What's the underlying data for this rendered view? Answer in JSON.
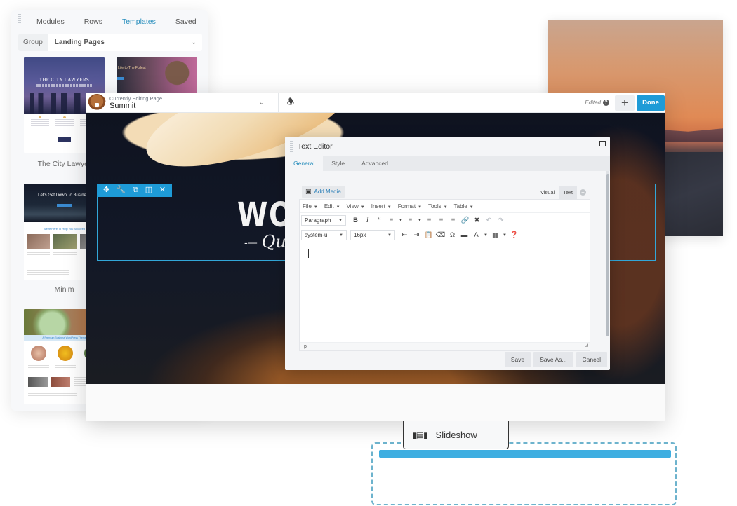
{
  "library": {
    "tabs": [
      {
        "label": "Modules",
        "active": false
      },
      {
        "label": "Rows",
        "active": false
      },
      {
        "label": "Templates",
        "active": true
      },
      {
        "label": "Saved",
        "active": false
      }
    ],
    "group_label": "Group",
    "group_value": "Landing Pages",
    "templates": [
      {
        "name": "The City Lawyers",
        "thumb_title": "THE CITY LAWYERS"
      },
      {
        "name": "",
        "thumb_title": "Life to The Fullest"
      },
      {
        "name": "Minim",
        "thumb_title": "Let's Get Down To Business",
        "section": "We're Here To Help You Succeed"
      },
      {
        "name": "",
        "thumb_title": "",
        "section": "A Premium Business WordPress Theme"
      }
    ],
    "visible_label_city": "The City Lawyer"
  },
  "builder": {
    "page_caption": "Currently Editing Page",
    "page_name": "Summit",
    "status": "Edited",
    "add_label": "+",
    "done_label": "Done",
    "hero_title": "WOO",
    "hero_sub": "Qu",
    "accent": "#1e9bd7"
  },
  "row_toolbar": {
    "icons": [
      "move-icon",
      "wrench-icon",
      "duplicate-icon",
      "columns-icon",
      "close-icon"
    ]
  },
  "dialog": {
    "title": "Text Editor",
    "tabs": [
      {
        "label": "General",
        "active": true
      },
      {
        "label": "Style",
        "active": false
      },
      {
        "label": "Advanced",
        "active": false
      }
    ],
    "add_media": "Add Media",
    "modes": {
      "visual": "Visual",
      "text": "Text"
    },
    "menu": [
      "File",
      "Edit",
      "View",
      "Insert",
      "Format",
      "Tools",
      "Table"
    ],
    "block_format": "Paragraph",
    "font_family": "system-ui",
    "font_size": "16px",
    "status_path": "p",
    "buttons": {
      "save": "Save",
      "save_as": "Save As...",
      "cancel": "Cancel"
    }
  },
  "drag": {
    "module_label": "Slideshow"
  }
}
